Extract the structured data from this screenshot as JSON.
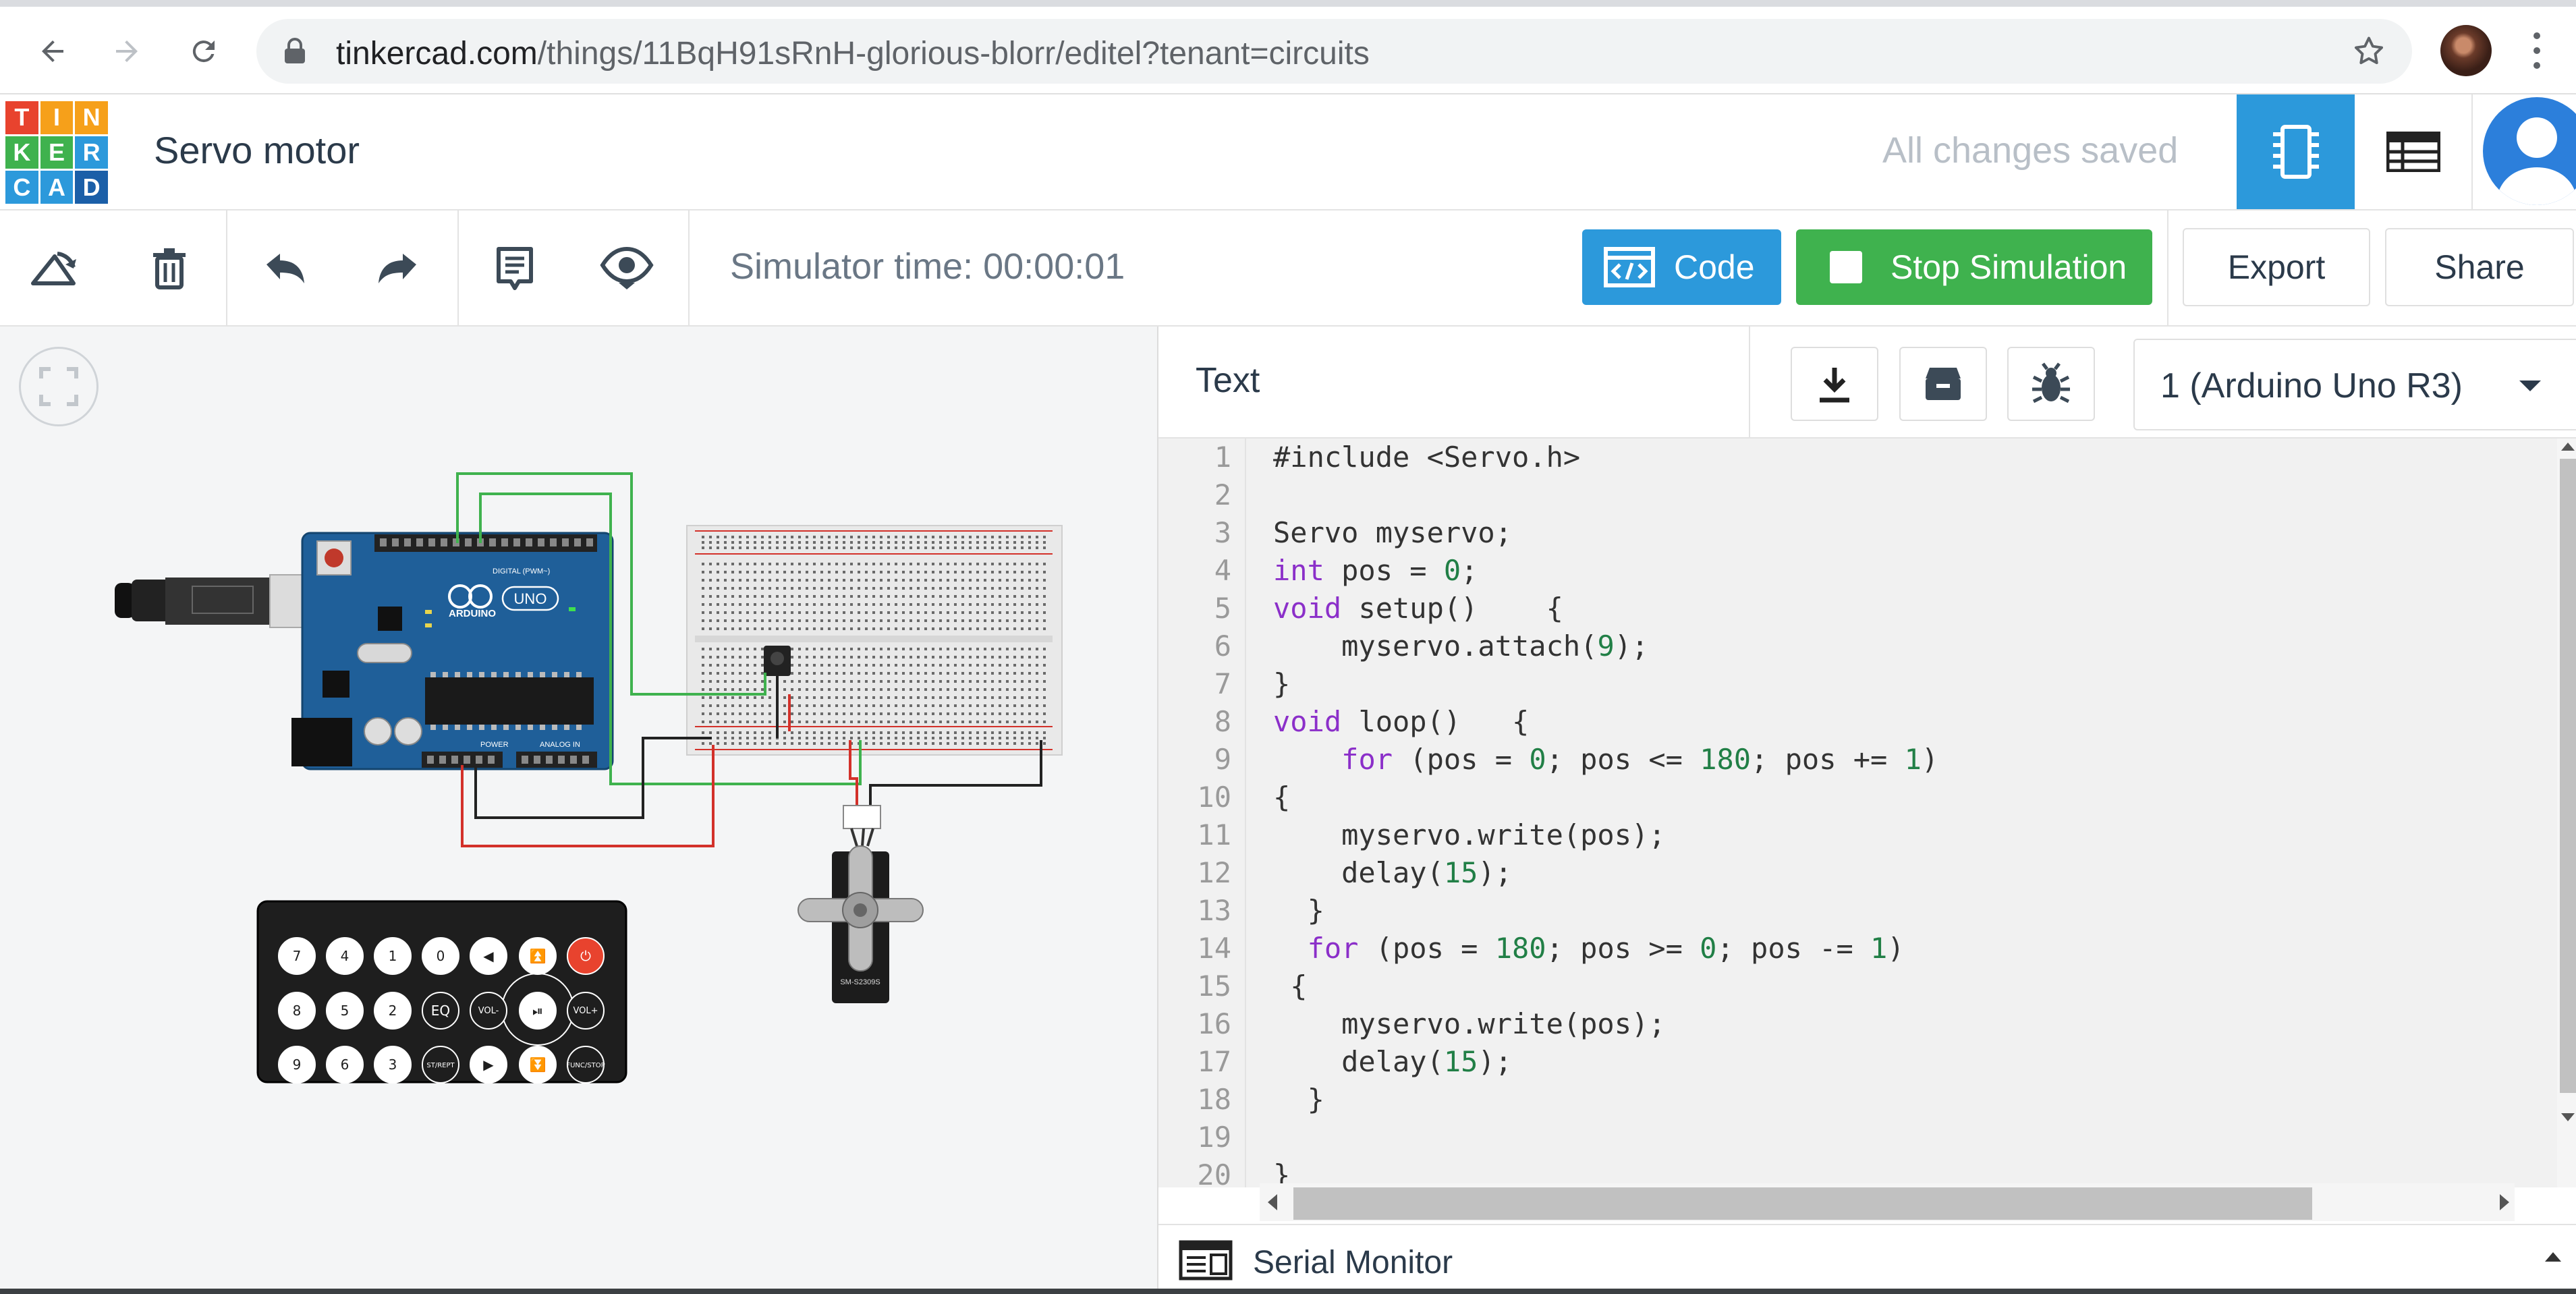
{
  "browser": {
    "url_host": "tinkercad.com",
    "url_path": "/things/11BqH91sRnH-glorious-blorr/editel?tenant=circuits"
  },
  "header": {
    "logo_letters": [
      "T",
      "I",
      "N",
      "K",
      "E",
      "R",
      "C",
      "A",
      "D"
    ],
    "logo_colors": [
      "#e8432e",
      "#f6a01a",
      "#f6a01a",
      "#3fb24e",
      "#3fb24e",
      "#2c99db",
      "#2c99db",
      "#2c99db",
      "#1b5fa8"
    ],
    "project_title": "Servo motor",
    "save_status": "All changes saved"
  },
  "toolbar": {
    "simulator_time": "Simulator time: 00:00:01",
    "code_label": "Code",
    "stop_label": "Stop Simulation",
    "export_label": "Export",
    "share_label": "Share"
  },
  "code_panel": {
    "mode_label": "Text",
    "device": "1 (Arduino Uno R3)",
    "serial_monitor_label": "Serial Monitor",
    "lines": [
      {
        "n": "1",
        "segments": [
          {
            "t": "#include <Servo.h>",
            "c": "plain"
          }
        ]
      },
      {
        "n": "2",
        "segments": []
      },
      {
        "n": "3",
        "segments": [
          {
            "t": "Servo myservo;",
            "c": "plain"
          }
        ]
      },
      {
        "n": "4",
        "segments": [
          {
            "t": "int",
            "c": "kw"
          },
          {
            "t": " pos = ",
            "c": "plain"
          },
          {
            "t": "0",
            "c": "num"
          },
          {
            "t": ";",
            "c": "plain"
          }
        ]
      },
      {
        "n": "5",
        "segments": [
          {
            "t": "void",
            "c": "kw"
          },
          {
            "t": " setup()    {",
            "c": "plain"
          }
        ]
      },
      {
        "n": "6",
        "segments": [
          {
            "t": "    myservo.attach(",
            "c": "plain"
          },
          {
            "t": "9",
            "c": "num"
          },
          {
            "t": ");",
            "c": "plain"
          }
        ]
      },
      {
        "n": "7",
        "segments": [
          {
            "t": "}",
            "c": "plain"
          }
        ]
      },
      {
        "n": "8",
        "segments": [
          {
            "t": "void",
            "c": "kw"
          },
          {
            "t": " loop()   {",
            "c": "plain"
          }
        ]
      },
      {
        "n": "9",
        "segments": [
          {
            "t": "    ",
            "c": "plain"
          },
          {
            "t": "for",
            "c": "kw"
          },
          {
            "t": " (pos = ",
            "c": "plain"
          },
          {
            "t": "0",
            "c": "num"
          },
          {
            "t": "; pos <= ",
            "c": "plain"
          },
          {
            "t": "180",
            "c": "num"
          },
          {
            "t": "; pos += ",
            "c": "plain"
          },
          {
            "t": "1",
            "c": "num"
          },
          {
            "t": ")",
            "c": "plain"
          }
        ]
      },
      {
        "n": "10",
        "segments": [
          {
            "t": "{",
            "c": "plain"
          }
        ]
      },
      {
        "n": "11",
        "segments": [
          {
            "t": "    myservo.write(pos);",
            "c": "plain"
          }
        ]
      },
      {
        "n": "12",
        "segments": [
          {
            "t": "    delay(",
            "c": "plain"
          },
          {
            "t": "15",
            "c": "num"
          },
          {
            "t": ");",
            "c": "plain"
          }
        ]
      },
      {
        "n": "13",
        "segments": [
          {
            "t": "  }",
            "c": "plain"
          }
        ]
      },
      {
        "n": "14",
        "segments": [
          {
            "t": "  ",
            "c": "plain"
          },
          {
            "t": "for",
            "c": "kw"
          },
          {
            "t": " (pos = ",
            "c": "plain"
          },
          {
            "t": "180",
            "c": "num"
          },
          {
            "t": "; pos >= ",
            "c": "plain"
          },
          {
            "t": "0",
            "c": "num"
          },
          {
            "t": "; pos -= ",
            "c": "plain"
          },
          {
            "t": "1",
            "c": "num"
          },
          {
            "t": ")",
            "c": "plain"
          }
        ]
      },
      {
        "n": "15",
        "segments": [
          {
            "t": " {",
            "c": "plain"
          }
        ]
      },
      {
        "n": "16",
        "segments": [
          {
            "t": "    myservo.write(pos);",
            "c": "plain"
          }
        ]
      },
      {
        "n": "17",
        "segments": [
          {
            "t": "    delay(",
            "c": "plain"
          },
          {
            "t": "15",
            "c": "num"
          },
          {
            "t": ");",
            "c": "plain"
          }
        ]
      },
      {
        "n": "18",
        "segments": [
          {
            "t": "  }",
            "c": "plain"
          }
        ]
      },
      {
        "n": "19",
        "segments": []
      },
      {
        "n": "20",
        "segments": [
          {
            "t": "}",
            "c": "plain"
          }
        ]
      }
    ]
  },
  "circuit": {
    "arduino_brand": "ARDUINO",
    "arduino_model": "UNO",
    "arduino_pwm_label": "DIGITAL (PWM~)",
    "arduino_power_label": "POWER",
    "arduino_analog_label": "ANALOG IN",
    "servo_model": "SM-S2309S",
    "remote_buttons": [
      "7",
      "4",
      "1",
      "0",
      "◀",
      "⏫",
      "⏻",
      "8",
      "5",
      "2",
      "EQ",
      "VOL-",
      "⏯",
      "VOL+",
      "9",
      "6",
      "3",
      "ST/REPT",
      "▶",
      "⏬",
      "FUNC/STOP"
    ]
  },
  "colors": {
    "accent_blue": "#2c99db",
    "sim_green": "#3fb24e",
    "wire_green": "#3fb24e",
    "wire_red": "#d3312a",
    "wire_black": "#333333",
    "arduino_blue": "#1f5f99"
  }
}
